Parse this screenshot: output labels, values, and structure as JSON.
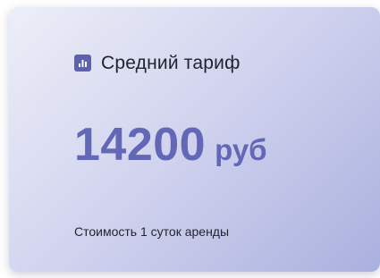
{
  "card": {
    "icon": "bar-chart-icon",
    "title": "Средний тариф",
    "value": "14200",
    "unit": "руб",
    "caption": "Стоимость 1 суток аренды"
  },
  "colors": {
    "accent": "#6368b6",
    "icon_bg": "#5c61b0",
    "gradient_start": "#eceef8",
    "gradient_end": "#aab0de"
  }
}
